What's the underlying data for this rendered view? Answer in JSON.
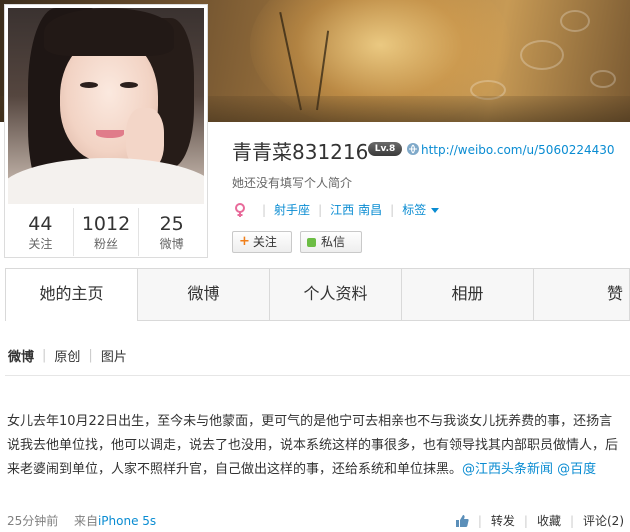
{
  "profile": {
    "name": "青青菜831216",
    "level_badge": "Lv.8",
    "url": "http://weibo.com/u/5060224430",
    "bio": "她还没有填写个人简介",
    "zodiac": "射手座",
    "province": "江西",
    "city": "南昌",
    "tags_label": "标签"
  },
  "stats": [
    {
      "value": "44",
      "label": "关注"
    },
    {
      "value": "1012",
      "label": "粉丝"
    },
    {
      "value": "25",
      "label": "微博"
    }
  ],
  "buttons": {
    "follow": "关注",
    "message": "私信"
  },
  "tabs": [
    "她的主页",
    "微博",
    "个人资料",
    "相册",
    "赞"
  ],
  "filters": [
    "微博",
    "原创",
    "图片"
  ],
  "post": {
    "text": "女儿去年10月22日出生，至今未与他蒙面，更可气的是他宁可去相亲也不与我谈女儿抚养费的事，还扬言说我去他单位找，他可以调走，说去了也没用，说本系统这样的事很多，也有领导找其内部职员做情人，后来老婆闹到单位，人家不照样升官，自己做出这样的事，还给系统和单位抹黑。",
    "mention1": "@江西头条新闻",
    "mention2": "@百度",
    "time": "25分钟前",
    "from_prefix": "来自",
    "source": "iPhone 5s",
    "repost": "转发",
    "favorite": "收藏",
    "comment": "评论(2)"
  },
  "colors": {
    "link": "#0a8cd2",
    "follow_plus": "#f07f1a",
    "message_dot": "#6cbd45"
  },
  "icons": [
    "link-icon",
    "female-icon",
    "chevron-down-icon",
    "plus-icon",
    "message-dot-icon",
    "thumbs-up-icon"
  ]
}
